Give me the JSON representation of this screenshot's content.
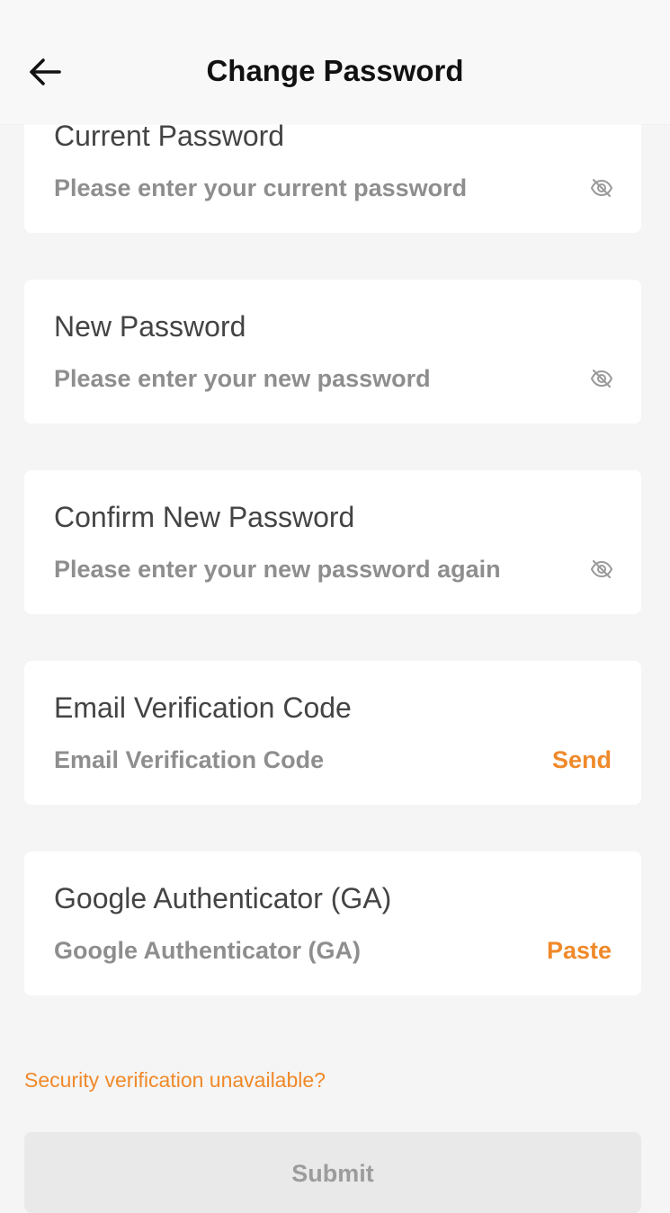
{
  "header": {
    "title": "Change Password",
    "back_icon": "arrow-left-icon"
  },
  "fields": {
    "current_password": {
      "label": "Current Password",
      "placeholder": "Please enter your current password",
      "value": "",
      "icon": "eye-off-icon"
    },
    "new_password": {
      "label": "New Password",
      "placeholder": "Please enter your new password",
      "value": "",
      "icon": "eye-off-icon"
    },
    "confirm_password": {
      "label": "Confirm New Password",
      "placeholder": "Please enter your new password again",
      "value": "",
      "icon": "eye-off-icon"
    },
    "email_code": {
      "label": "Email Verification Code",
      "placeholder": "Email Verification Code",
      "value": "",
      "action_label": "Send"
    },
    "google_auth": {
      "label": "Google Authenticator (GA)",
      "placeholder": "Google Authenticator (GA)",
      "value": "",
      "action_label": "Paste"
    }
  },
  "security_link": "Security verification unavailable?",
  "submit_label": "Submit",
  "colors": {
    "accent": "#f0892a",
    "background": "#f5f5f5",
    "card": "#ffffff",
    "submit_disabled_bg": "#e9e9e9",
    "submit_disabled_text": "#9c9c9c"
  }
}
